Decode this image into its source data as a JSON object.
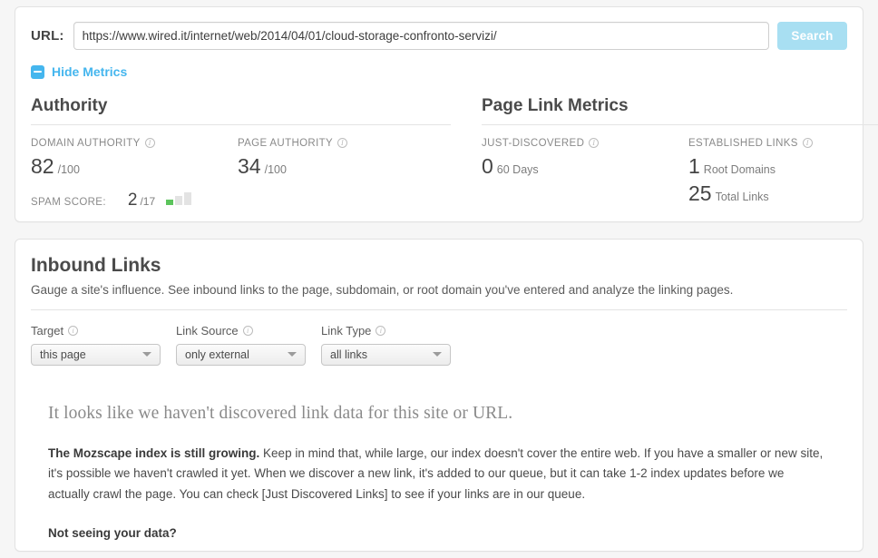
{
  "search": {
    "url_label": "URL:",
    "url_value": "https://www.wired.it/internet/web/2014/04/01/cloud-storage-confronto-servizi/",
    "url_placeholder": "Enter a URL",
    "search_button": "Search"
  },
  "toggle": {
    "hide_metrics_label": "Hide Metrics"
  },
  "authority": {
    "title": "Authority",
    "domain_authority": {
      "label": "DOMAIN AUTHORITY",
      "value": "82",
      "unit": "/100"
    },
    "page_authority": {
      "label": "PAGE AUTHORITY",
      "value": "34",
      "unit": "/100"
    },
    "spam_score": {
      "label": "SPAM SCORE:",
      "value": "2",
      "unit": "/17",
      "bars_filled": 1,
      "bars_total": 3,
      "fill_color": "#5cc45c",
      "empty_color": "#e3e3e3"
    }
  },
  "page_link_metrics": {
    "title": "Page Link Metrics",
    "just_discovered": {
      "label": "JUST-DISCOVERED",
      "value": "0",
      "unit": "60 Days"
    },
    "established_links": {
      "label": "ESTABLISHED LINKS",
      "root_domains_value": "1",
      "root_domains_unit": "Root Domains",
      "total_links_value": "25",
      "total_links_unit": "Total Links"
    }
  },
  "inbound_links": {
    "title": "Inbound Links",
    "description": "Gauge a site's influence. See inbound links to the page, subdomain, or root domain you've entered and analyze the linking pages.",
    "filters": [
      {
        "label": "Target",
        "value": "this page"
      },
      {
        "label": "Link Source",
        "value": "only external"
      },
      {
        "label": "Link Type",
        "value": "all links"
      }
    ],
    "empty_state": {
      "headline": "It looks like we haven't discovered link data for this site or URL.",
      "body_bold": "The Mozscape index is still growing.",
      "body_text": " Keep in mind that, while large, our index doesn't cover the entire web. If you have a smaller or new site, it's possible we haven't crawled it yet. When we discover a new link, it's added to our queue, but it can take 1-2 index updates before we actually crawl the page. You can check [Just Discovered Links] to see if your links are in our queue.",
      "sub_heading": "Not seeing your data?"
    }
  },
  "icons": {
    "info": "i",
    "minus": "minus-icon",
    "caret_down": "chevron-down-icon"
  },
  "colors": {
    "accent_blue": "#45b6ee",
    "button_blue": "#a8dff2",
    "page_bg": "#f6f6f6",
    "card_bg": "#ffffff"
  }
}
